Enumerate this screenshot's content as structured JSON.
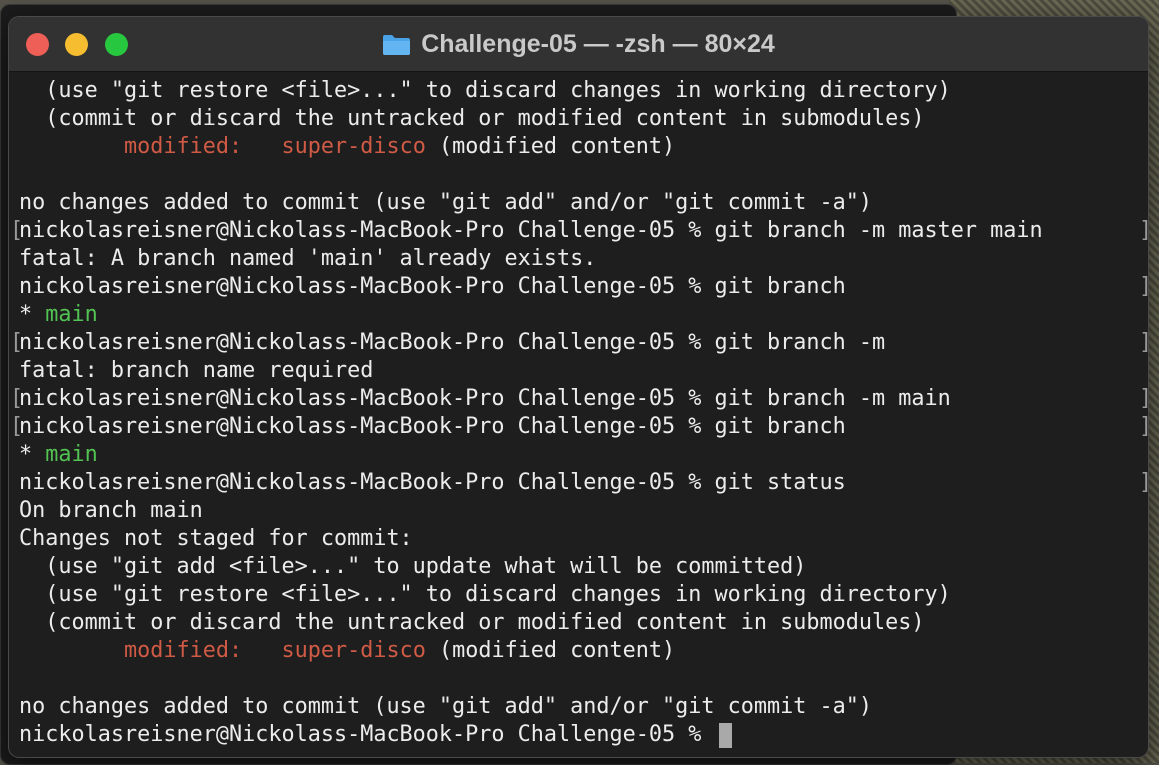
{
  "window": {
    "title": "Challenge-05 — -zsh — 80×24",
    "folder_icon": "folder-icon",
    "traffic_lights": {
      "close": "#ee5f57",
      "minimize": "#f5bd2f",
      "maximize": "#27c740"
    }
  },
  "terminal": {
    "prompt": "nickolasreisner@Nickolass-MacBook-Pro Challenge-05 %",
    "colors": {
      "text": "#ececec",
      "modified": "#cf5a45",
      "branch": "#52c252",
      "cursor": "#a9a9a9"
    },
    "lines": {
      "l0": "  (use \"git restore <file>...\" to discard changes in working directory)",
      "l1": "  (commit or discard the untracked or modified content in submodules)",
      "l2_indent": "        ",
      "l2_label": "modified:",
      "l2_gap": "   ",
      "l2_name": "super-disco",
      "l2_tail": " (modified content)",
      "l4": "no changes added to commit (use \"git add\" and/or \"git commit -a\")",
      "l5_cmd": "git branch -m master main",
      "l6": "fatal: A branch named 'main' already exists.",
      "l7_cmd": "git branch",
      "l8_star": "* ",
      "l8_branch": "main",
      "l9_cmd": "git branch -m",
      "l10": "fatal: branch name required",
      "l11_cmd": "git branch -m main",
      "l12_cmd": "git branch",
      "l13_star": "* ",
      "l13_branch": "main",
      "l14_cmd": "git status",
      "l15": "On branch main",
      "l16": "Changes not staged for commit:",
      "l17": "  (use \"git add <file>...\" to update what will be committed)",
      "l18": "  (use \"git restore <file>...\" to discard changes in working directory)",
      "l19": "  (commit or discard the untracked or modified content in submodules)",
      "l20_indent": "        ",
      "l20_label": "modified:",
      "l20_gap": "   ",
      "l20_name": "super-disco",
      "l20_tail": " (modified content)",
      "l22": "no changes added to commit (use \"git add\" and/or \"git commit -a\")"
    },
    "bracket_left": "[",
    "bracket_right": "]"
  }
}
